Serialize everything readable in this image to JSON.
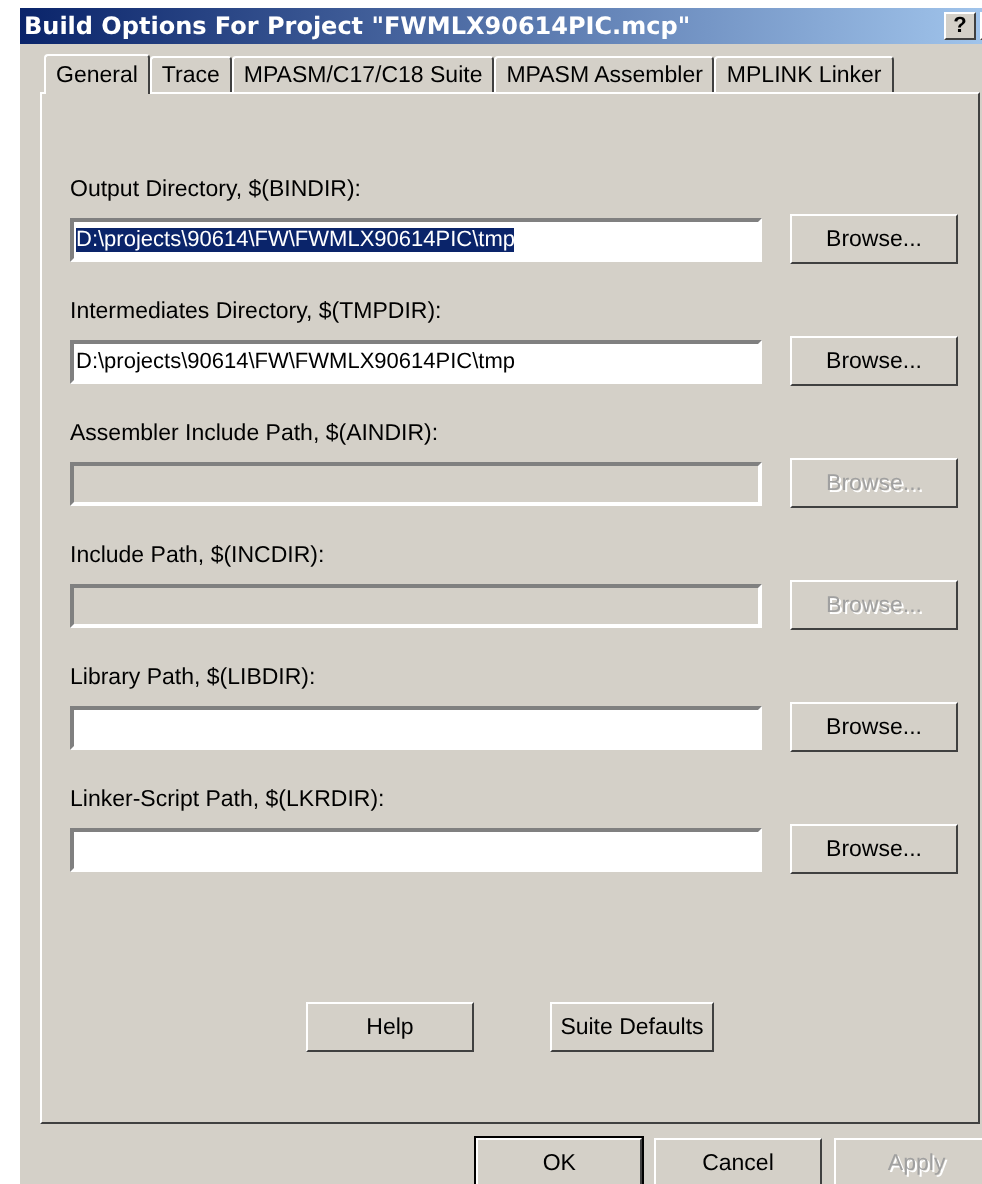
{
  "window": {
    "title": "Build Options For Project \"FWMLX90614PIC.mcp\"",
    "help_button": "?"
  },
  "tabs": [
    {
      "label": "General",
      "selected": true
    },
    {
      "label": "Trace",
      "selected": false
    },
    {
      "label": "MPASM/C17/C18 Suite",
      "selected": false
    },
    {
      "label": "MPASM Assembler",
      "selected": false
    },
    {
      "label": "MPLINK Linker",
      "selected": false
    }
  ],
  "fields": [
    {
      "label": "Output Directory, $(BINDIR):",
      "value": "D:\\projects\\90614\\FW\\FWMLX90614PIC\\tmp",
      "text_selected": true,
      "disabled": false,
      "browse": "Browse..."
    },
    {
      "label": "Intermediates Directory, $(TMPDIR):",
      "value": "D:\\projects\\90614\\FW\\FWMLX90614PIC\\tmp",
      "text_selected": false,
      "disabled": false,
      "browse": "Browse..."
    },
    {
      "label": "Assembler Include Path, $(AINDIR):",
      "disabled": true,
      "browse": "Browse..."
    },
    {
      "label": "Include Path, $(INCDIR):",
      "disabled": true,
      "browse": "Browse..."
    },
    {
      "label": "Library Path, $(LIBDIR):",
      "disabled": false,
      "browse": "Browse..."
    },
    {
      "label": "Linker-Script Path, $(LKRDIR):",
      "disabled": false,
      "browse": "Browse..."
    }
  ],
  "panel_buttons": [
    "Help",
    "Suite Defaults"
  ],
  "dialog_buttons": [
    {
      "label": "OK",
      "default": true,
      "disabled": false
    },
    {
      "label": "Cancel",
      "default": false,
      "disabled": false
    },
    {
      "label": "Apply",
      "default": false,
      "disabled": true
    }
  ]
}
